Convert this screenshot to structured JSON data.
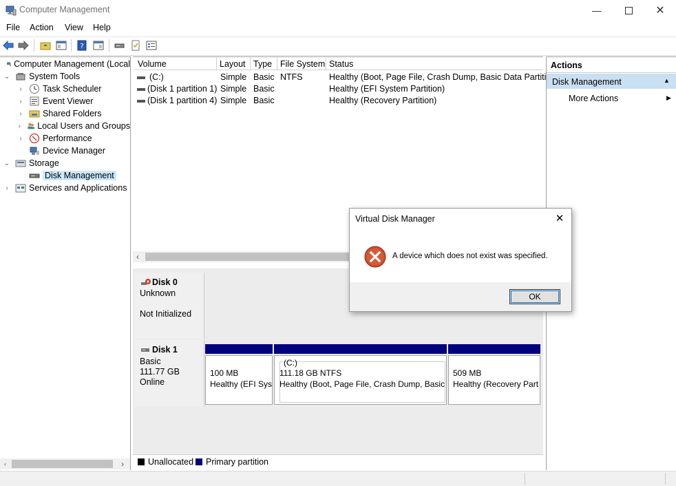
{
  "window": {
    "title": "Computer Management"
  },
  "menu": [
    "File",
    "Action",
    "View",
    "Help"
  ],
  "tree": [
    {
      "label": "Computer Management (Local",
      "icon": "computer-icon",
      "level": 0,
      "chevron": ""
    },
    {
      "label": "System Tools",
      "icon": "tools-icon",
      "level": 1,
      "chevron": "⌄"
    },
    {
      "label": "Task Scheduler",
      "icon": "clock-icon",
      "level": 2,
      "chevron": "›"
    },
    {
      "label": "Event Viewer",
      "icon": "event-viewer-icon",
      "level": 2,
      "chevron": "›"
    },
    {
      "label": "Shared Folders",
      "icon": "shared-folder-icon",
      "level": 2,
      "chevron": "›"
    },
    {
      "label": "Local Users and Groups",
      "icon": "users-icon",
      "level": 2,
      "chevron": "›"
    },
    {
      "label": "Performance",
      "icon": "performance-icon",
      "level": 2,
      "chevron": "›"
    },
    {
      "label": "Device Manager",
      "icon": "device-manager-icon",
      "level": 2,
      "chevron": ""
    },
    {
      "label": "Storage",
      "icon": "storage-icon",
      "level": 1,
      "chevron": "⌄"
    },
    {
      "label": "Disk Management",
      "icon": "disk-icon",
      "level": 2,
      "chevron": "",
      "selected": true
    },
    {
      "label": "Services and Applications",
      "icon": "services-icon",
      "level": 1,
      "chevron": "›"
    }
  ],
  "volumes": {
    "headers": [
      "Volume",
      "Layout",
      "Type",
      "File System",
      "Status"
    ],
    "rows": [
      [
        "(C:)",
        "Simple",
        "Basic",
        "NTFS",
        "Healthy (Boot, Page File, Crash Dump, Basic Data Partition)"
      ],
      [
        "(Disk 1 partition 1)",
        "Simple",
        "Basic",
        "",
        "Healthy (EFI System Partition)"
      ],
      [
        "(Disk 1 partition 4)",
        "Simple",
        "Basic",
        "",
        "Healthy (Recovery Partition)"
      ]
    ]
  },
  "disks": {
    "disk0": {
      "name": "Disk 0",
      "type": "Unknown",
      "state": "Not Initialized"
    },
    "disk1": {
      "name": "Disk 1",
      "type": "Basic",
      "size": "111.77 GB",
      "state": "Online",
      "partitions": [
        {
          "name": "",
          "size": "100 MB",
          "status": "Healthy (EFI Sys"
        },
        {
          "name": "(C:)",
          "size": "111.18 GB NTFS",
          "status": "Healthy (Boot, Page File, Crash Dump, Basic I"
        },
        {
          "name": "",
          "size": "509 MB",
          "status": "Healthy (Recovery Part"
        }
      ]
    }
  },
  "legend": {
    "unallocated": "Unallocated",
    "primary": "Primary partition",
    "unallocated_color": "#000000",
    "primary_color": "#00007f"
  },
  "actions": {
    "title": "Actions",
    "section": "Disk Management",
    "more": "More Actions"
  },
  "dialog": {
    "title": "Virtual Disk Manager",
    "message": "A device which does not exist was specified.",
    "ok": "OK"
  },
  "colors": {
    "selected": "#cce8ff",
    "section": "#c9dff2",
    "partbar": "#00007f"
  }
}
